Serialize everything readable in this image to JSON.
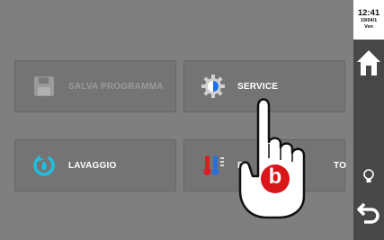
{
  "header": {
    "time": "12:41",
    "date": "19/04/1",
    "day": "Ven"
  },
  "menu": {
    "salva_label": "SALVA PROGRAMMA",
    "service_label": "SERVICE",
    "lavaggio_label": "LAVAGGIO",
    "raff_label_left": "R",
    "raff_label_right": "TO"
  },
  "overlay": {
    "badge_letter": "b"
  },
  "colors": {
    "accent_blue": "#1a73e8",
    "badge_red": "#d9161a",
    "cool_blue": "#2b6fd6",
    "hot_red": "#d62020"
  }
}
